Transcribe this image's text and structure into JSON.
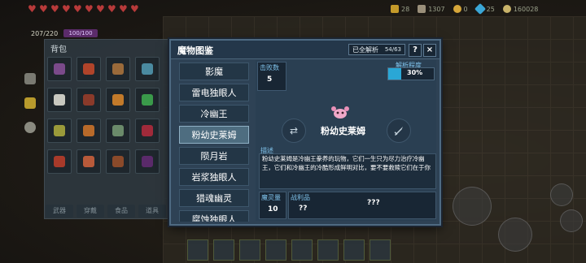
{
  "hud": {
    "hearts": [
      "♥",
      "♥",
      "♥",
      "♥",
      "♥",
      "♥",
      "♥",
      "♥",
      "♥",
      "♥"
    ],
    "hp": "207/220",
    "shield": "100/100",
    "currency": [
      {
        "icon": "gold-bag-icon",
        "value": "28",
        "color": "#c49a2a"
      },
      {
        "icon": "gem-icon",
        "value": "1307",
        "color": "#9a8f7a"
      },
      {
        "icon": "key-icon",
        "value": "0",
        "color": "#d6a63a"
      },
      {
        "icon": "diamond-icon",
        "value": "25",
        "color": "#3aa6d6"
      },
      {
        "icon": "coin-icon",
        "value": "160028",
        "color": "#c9b36a"
      }
    ]
  },
  "backpack": {
    "title": "背包",
    "tabs": [
      "武器",
      "穿戴",
      "食品",
      "道具"
    ]
  },
  "dialog": {
    "title": "魔物图鉴",
    "unlock_label": "已全解析",
    "unlock_count": "54/63",
    "help_label": "?",
    "close_label": "×",
    "list": [
      "影魔",
      "雷电独眼人",
      "冷幽王",
      "粉幼史莱姆",
      "陨月岩",
      "岩浆独眼人",
      "猎魂幽灵",
      "腐蚀独眼人"
    ],
    "selected_index": 3,
    "kills_label": "击败数",
    "kills_value": "5",
    "progress_label": "解析程度",
    "progress_value": "30%",
    "progress_fraction": 0.3,
    "monster_name": "粉幼史莱姆",
    "desc_label": "描述",
    "description": "粉幼史莱姆是冷幽王豢养的玩物，它们一生只为尽力治疗冷幽王，它们和冷幽王的冷酷形成鲜明对比，要不要救赎它们在于你",
    "mana_label": "魔灵量",
    "mana_value": "10",
    "loot_label": "战利品",
    "loot_a": "??",
    "loot_b": "???",
    "prev_icon": "swap-icon",
    "next_icon": "sword-icon"
  },
  "colors": {
    "accent": "#2aa7d6",
    "panel": "#2e4255",
    "selected": "#4e6d80",
    "monster": "#f0a8c8"
  }
}
